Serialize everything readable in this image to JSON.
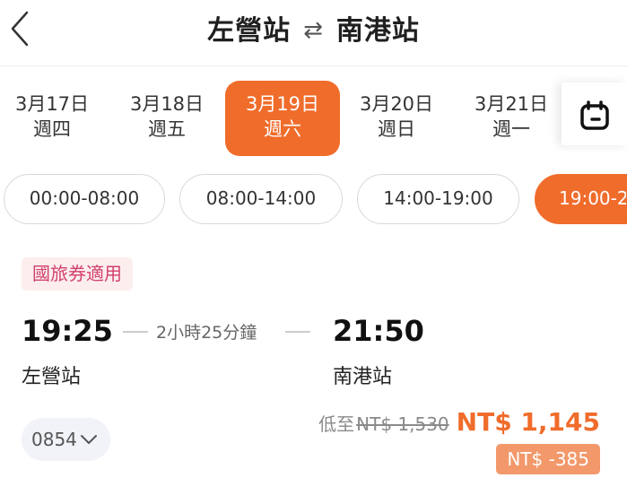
{
  "header": {
    "from_station": "左營站",
    "swap_icon": "⇄",
    "to_station": "南港站"
  },
  "dates": [
    {
      "date": "3月17日",
      "weekday": "週四",
      "selected": false
    },
    {
      "date": "3月18日",
      "weekday": "週五",
      "selected": false
    },
    {
      "date": "3月19日",
      "weekday": "週六",
      "selected": true
    },
    {
      "date": "3月20日",
      "weekday": "週日",
      "selected": false
    },
    {
      "date": "3月21日",
      "weekday": "週一",
      "selected": false
    }
  ],
  "calendar_icon": "calendar-icon",
  "time_filters": [
    {
      "label": "00:00-08:00",
      "selected": false
    },
    {
      "label": "08:00-14:00",
      "selected": false
    },
    {
      "label": "14:00-19:00",
      "selected": false
    },
    {
      "label": "19:00-2",
      "selected": true
    }
  ],
  "trip": {
    "voucher_tag": "國旅券適用",
    "depart_time": "19:25",
    "duration": "2小時25分鐘",
    "arrive_time": "21:50",
    "depart_station": "左營站",
    "arrive_station": "南港站",
    "train_number": "0854",
    "price_prefix": "低至",
    "original_price": "NT$ 1,530",
    "current_price": "NT$ 1,145",
    "discount": "NT$ -385"
  },
  "colors": {
    "accent": "#f06c2b",
    "tag_bg": "#fdeeee",
    "tag_text": "#d1406a",
    "discount_bg": "#f2986a"
  }
}
